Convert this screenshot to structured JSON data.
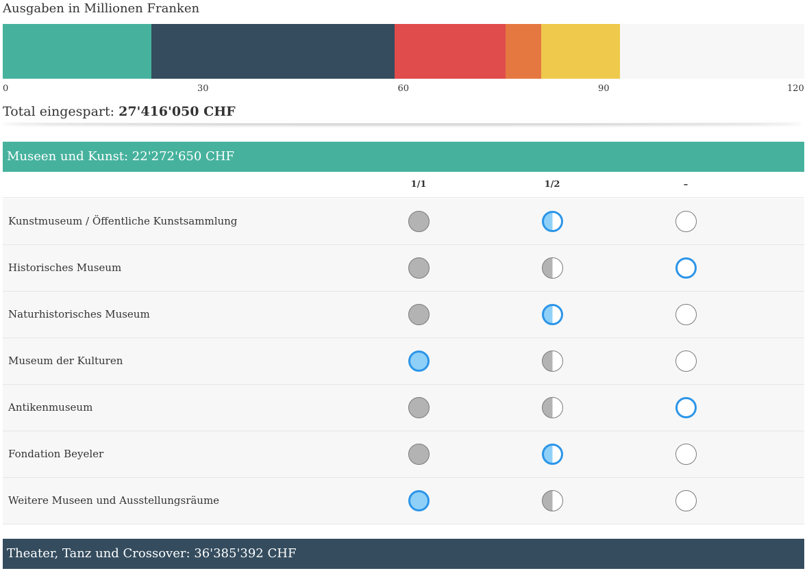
{
  "colors": {
    "museen": "#46b29d",
    "theater": "#344c5e",
    "seg3": "#e04b4c",
    "seg4": "#e57841",
    "seg5": "#efc94c",
    "bar_background": "#f7f7f7",
    "selected_ring": "#2b95e8",
    "selected_fill": "#8fd0f8",
    "unselected_fill": "#b3b3b3"
  },
  "chart_data": {
    "type": "bar",
    "orientation": "horizontal-stacked",
    "title": "Ausgaben in Millionen Franken",
    "xlim": [
      0,
      120
    ],
    "ticks": [
      "0",
      "30",
      "60",
      "90",
      "120"
    ],
    "tick_values": [
      0,
      30,
      60,
      90,
      120
    ],
    "series": [
      {
        "values": [
          22.27
        ]
      },
      {
        "values": [
          36.39
        ]
      },
      {
        "values": [
          16.6
        ]
      },
      {
        "values": [
          5.4
        ]
      },
      {
        "values": [
          11.8
        ]
      }
    ],
    "grid": false,
    "legend": "none"
  },
  "total": {
    "label": "Total eingespart:",
    "value": "27'416'050 CHF"
  },
  "sections": [
    {
      "title": "Museen und Kunst: 22'272'650 CHF"
    },
    {
      "title": "Theater, Tanz und Crossover: 36'385'392 CHF"
    }
  ],
  "columns": [
    "1/1",
    "1/2",
    "–"
  ],
  "rows": [
    {
      "label": "Kunstmuseum / Öffentliche Kunstsammlung",
      "selected": 1
    },
    {
      "label": "Historisches Museum",
      "selected": 2
    },
    {
      "label": "Naturhistorisches Museum",
      "selected": 1
    },
    {
      "label": "Museum der Kulturen",
      "selected": 0
    },
    {
      "label": "Antikenmuseum",
      "selected": 2
    },
    {
      "label": "Fondation Beyeler",
      "selected": 1
    },
    {
      "label": "Weitere Museen und Ausstellungsräume",
      "selected": 0
    }
  ]
}
